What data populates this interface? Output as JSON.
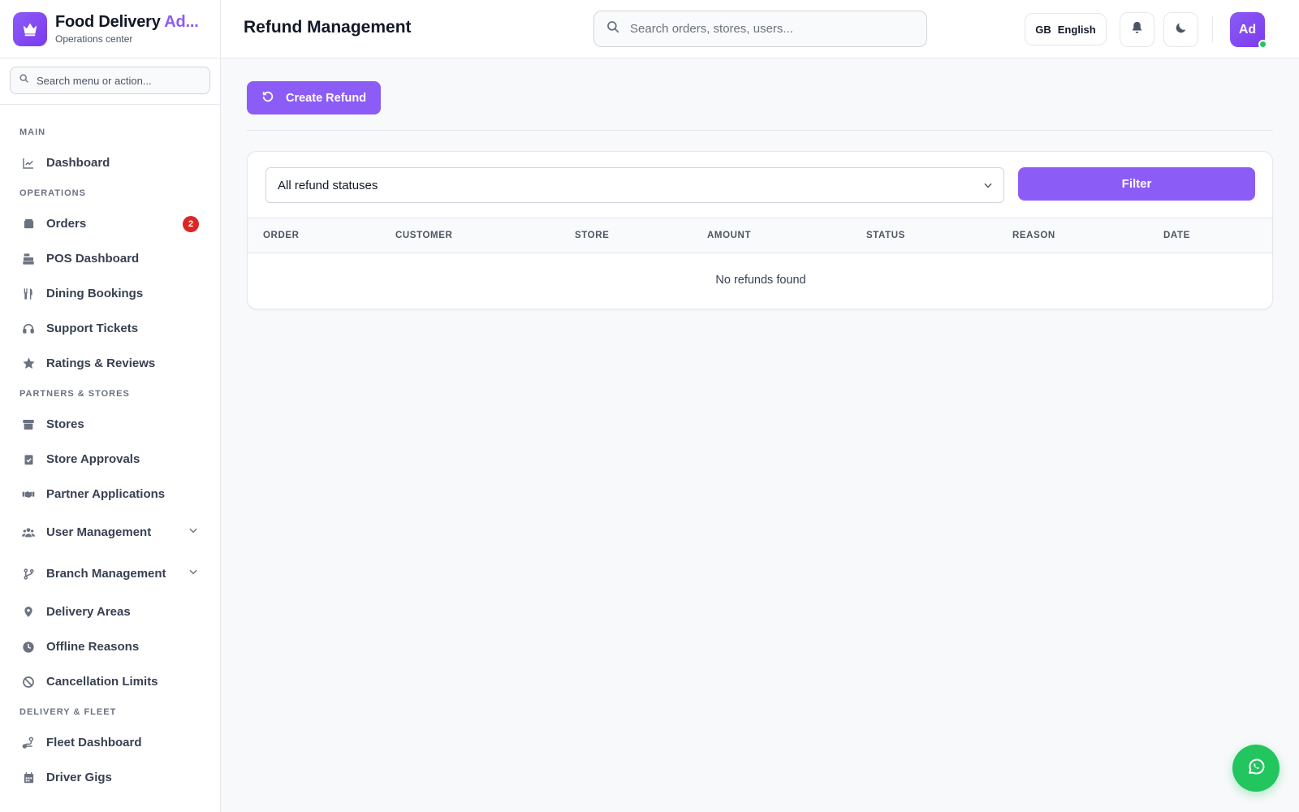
{
  "brand": {
    "title_main": "Food Delivery ",
    "title_accent": "Ad...",
    "subtitle": "Operations center"
  },
  "sidebar": {
    "search_placeholder": "Search menu or action...",
    "sections": [
      {
        "label": "MAIN"
      },
      {
        "label": "OPERATIONS"
      },
      {
        "label": "PARTNERS & STORES"
      },
      {
        "label": "DELIVERY & FLEET"
      }
    ],
    "items": [
      {
        "label": "Dashboard",
        "icon": "chart-line-icon"
      },
      {
        "label": "Orders",
        "icon": "box-icon",
        "badge": "2"
      },
      {
        "label": "POS Dashboard",
        "icon": "cash-register-icon"
      },
      {
        "label": "Dining Bookings",
        "icon": "utensils-icon"
      },
      {
        "label": "Support Tickets",
        "icon": "headset-icon"
      },
      {
        "label": "Ratings & Reviews",
        "icon": "star-icon"
      },
      {
        "label": "Stores",
        "icon": "store-icon"
      },
      {
        "label": "Store Approvals",
        "icon": "clipboard-check-icon"
      },
      {
        "label": "Partner Applications",
        "icon": "handshake-icon"
      },
      {
        "label": "User Management",
        "icon": "users-icon"
      },
      {
        "label": "Branch Management",
        "icon": "code-branch-icon"
      },
      {
        "label": "Delivery Areas",
        "icon": "map-pin-icon"
      },
      {
        "label": "Offline Reasons",
        "icon": "clock-icon"
      },
      {
        "label": "Cancellation Limits",
        "icon": "ban-icon"
      },
      {
        "label": "Fleet Dashboard",
        "icon": "route-icon"
      },
      {
        "label": "Driver Gigs",
        "icon": "calendar-icon"
      }
    ]
  },
  "header": {
    "title": "Refund Management",
    "search_placeholder": "Search orders, stores, users...",
    "lang_code": "GB",
    "lang_label": "English",
    "avatar_initials": "Ad"
  },
  "main": {
    "create_button": "Create Refund",
    "filter": {
      "selected": "All refund statuses",
      "button": "Filter"
    },
    "table": {
      "columns": [
        "ORDER",
        "CUSTOMER",
        "STORE",
        "AMOUNT",
        "STATUS",
        "REASON",
        "DATE"
      ],
      "empty_message": "No refunds found"
    }
  },
  "colors": {
    "accent": "#8b5cf6",
    "badge": "#dc2626",
    "whatsapp": "#22c55e",
    "online": "#22c55e"
  }
}
